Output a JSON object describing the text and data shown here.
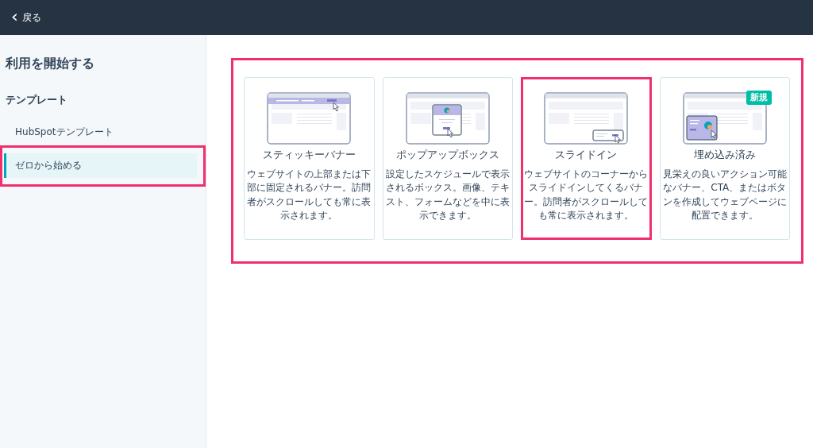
{
  "top_bar": {
    "back_icon": "‹",
    "back_label": "戻る"
  },
  "sidebar": {
    "title": "利用を開始する",
    "section": "テンプレート",
    "items": [
      {
        "label": "HubSpotテンプレート",
        "selected": false,
        "highlighted": false
      },
      {
        "label": "ゼロから始める",
        "selected": true,
        "highlighted": true
      }
    ]
  },
  "card_grid": {
    "highlighted": true,
    "cards": [
      {
        "kind": "sticky",
        "title": "スティッキーバナー",
        "description": "ウェブサイトの上部または下部に固定されるバナー。訪問者がスクロールしても常に表示されます。",
        "highlighted": false
      },
      {
        "kind": "popup",
        "title": "ポップアップボックス",
        "description": "設定したスケジュールで表示されるボックス。画像、テキスト、フォームなどを中に表示できます。",
        "highlighted": false
      },
      {
        "kind": "slidein",
        "title": "スライドイン",
        "description": "ウェブサイトのコーナーからスライドインしてくるバナー。訪問者がスクロールしても常に表示されます。",
        "highlighted": true
      },
      {
        "kind": "embedded",
        "title": "埋め込み済み",
        "description": "見栄えの良いアクション可能なバナー、CTA、またはボタンを作成してウェブページに配置できます。",
        "highlighted": false,
        "badge": "新規"
      }
    ]
  }
}
